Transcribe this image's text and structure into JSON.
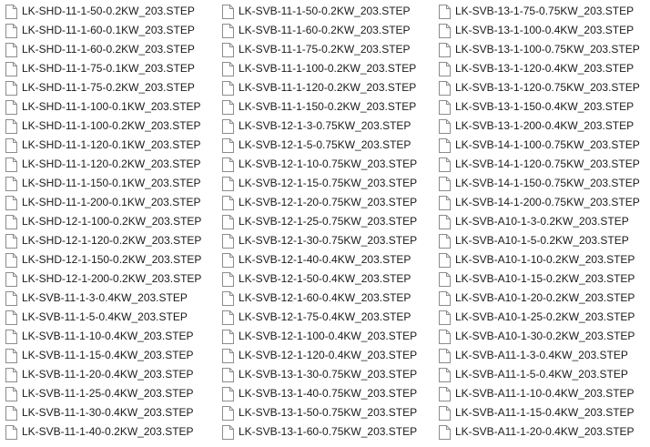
{
  "icon": "blank-file-icon",
  "columns": [
    {
      "files": [
        "LK-SHD-11-1-50-0.2KW_203.STEP",
        "LK-SHD-11-1-60-0.1KW_203.STEP",
        "LK-SHD-11-1-60-0.2KW_203.STEP",
        "LK-SHD-11-1-75-0.1KW_203.STEP",
        "LK-SHD-11-1-75-0.2KW_203.STEP",
        "LK-SHD-11-1-100-0.1KW_203.STEP",
        "LK-SHD-11-1-100-0.2KW_203.STEP",
        "LK-SHD-11-1-120-0.1KW_203.STEP",
        "LK-SHD-11-1-120-0.2KW_203.STEP",
        "LK-SHD-11-1-150-0.1KW_203.STEP",
        "LK-SHD-11-1-200-0.1KW_203.STEP",
        "LK-SHD-12-1-100-0.2KW_203.STEP",
        "LK-SHD-12-1-120-0.2KW_203.STEP",
        "LK-SHD-12-1-150-0.2KW_203.STEP",
        "LK-SHD-12-1-200-0.2KW_203.STEP",
        "LK-SVB-11-1-3-0.4KW_203.STEP",
        "LK-SVB-11-1-5-0.4KW_203.STEP",
        "LK-SVB-11-1-10-0.4KW_203.STEP",
        "LK-SVB-11-1-15-0.4KW_203.STEP",
        "LK-SVB-11-1-20-0.4KW_203.STEP",
        "LK-SVB-11-1-25-0.4KW_203.STEP",
        "LK-SVB-11-1-30-0.4KW_203.STEP",
        "LK-SVB-11-1-40-0.2KW_203.STEP"
      ]
    },
    {
      "files": [
        "LK-SVB-11-1-50-0.2KW_203.STEP",
        "LK-SVB-11-1-60-0.2KW_203.STEP",
        "LK-SVB-11-1-75-0.2KW_203.STEP",
        "LK-SVB-11-1-100-0.2KW_203.STEP",
        "LK-SVB-11-1-120-0.2KW_203.STEP",
        "LK-SVB-11-1-150-0.2KW_203.STEP",
        "LK-SVB-12-1-3-0.75KW_203.STEP",
        "LK-SVB-12-1-5-0.75KW_203.STEP",
        "LK-SVB-12-1-10-0.75KW_203.STEP",
        "LK-SVB-12-1-15-0.75KW_203.STEP",
        "LK-SVB-12-1-20-0.75KW_203.STEP",
        "LK-SVB-12-1-25-0.75KW_203.STEP",
        "LK-SVB-12-1-30-0.75KW_203.STEP",
        "LK-SVB-12-1-40-0.4KW_203.STEP",
        "LK-SVB-12-1-50-0.4KW_203.STEP",
        "LK-SVB-12-1-60-0.4KW_203.STEP",
        "LK-SVB-12-1-75-0.4KW_203.STEP",
        "LK-SVB-12-1-100-0.4KW_203.STEP",
        "LK-SVB-12-1-120-0.4KW_203.STEP",
        "LK-SVB-13-1-30-0.75KW_203.STEP",
        "LK-SVB-13-1-40-0.75KW_203.STEP",
        "LK-SVB-13-1-50-0.75KW_203.STEP",
        "LK-SVB-13-1-60-0.75KW_203.STEP"
      ]
    },
    {
      "files": [
        "LK-SVB-13-1-75-0.75KW_203.STEP",
        "LK-SVB-13-1-100-0.4KW_203.STEP",
        "LK-SVB-13-1-100-0.75KW_203.STEP",
        "LK-SVB-13-1-120-0.4KW_203.STEP",
        "LK-SVB-13-1-120-0.75KW_203.STEP",
        "LK-SVB-13-1-150-0.4KW_203.STEP",
        "LK-SVB-13-1-200-0.4KW_203.STEP",
        "LK-SVB-14-1-100-0.75KW_203.STEP",
        "LK-SVB-14-1-120-0.75KW_203.STEP",
        "LK-SVB-14-1-150-0.75KW_203.STEP",
        "LK-SVB-14-1-200-0.75KW_203.STEP",
        "LK-SVB-A10-1-3-0.2KW_203.STEP",
        "LK-SVB-A10-1-5-0.2KW_203.STEP",
        "LK-SVB-A10-1-10-0.2KW_203.STEP",
        "LK-SVB-A10-1-15-0.2KW_203.STEP",
        "LK-SVB-A10-1-20-0.2KW_203.STEP",
        "LK-SVB-A10-1-25-0.2KW_203.STEP",
        "LK-SVB-A10-1-30-0.2KW_203.STEP",
        "LK-SVB-A11-1-3-0.4KW_203.STEP",
        "LK-SVB-A11-1-5-0.4KW_203.STEP",
        "LK-SVB-A11-1-10-0.4KW_203.STEP",
        "LK-SVB-A11-1-15-0.4KW_203.STEP",
        "LK-SVB-A11-1-20-0.4KW_203.STEP"
      ]
    }
  ]
}
